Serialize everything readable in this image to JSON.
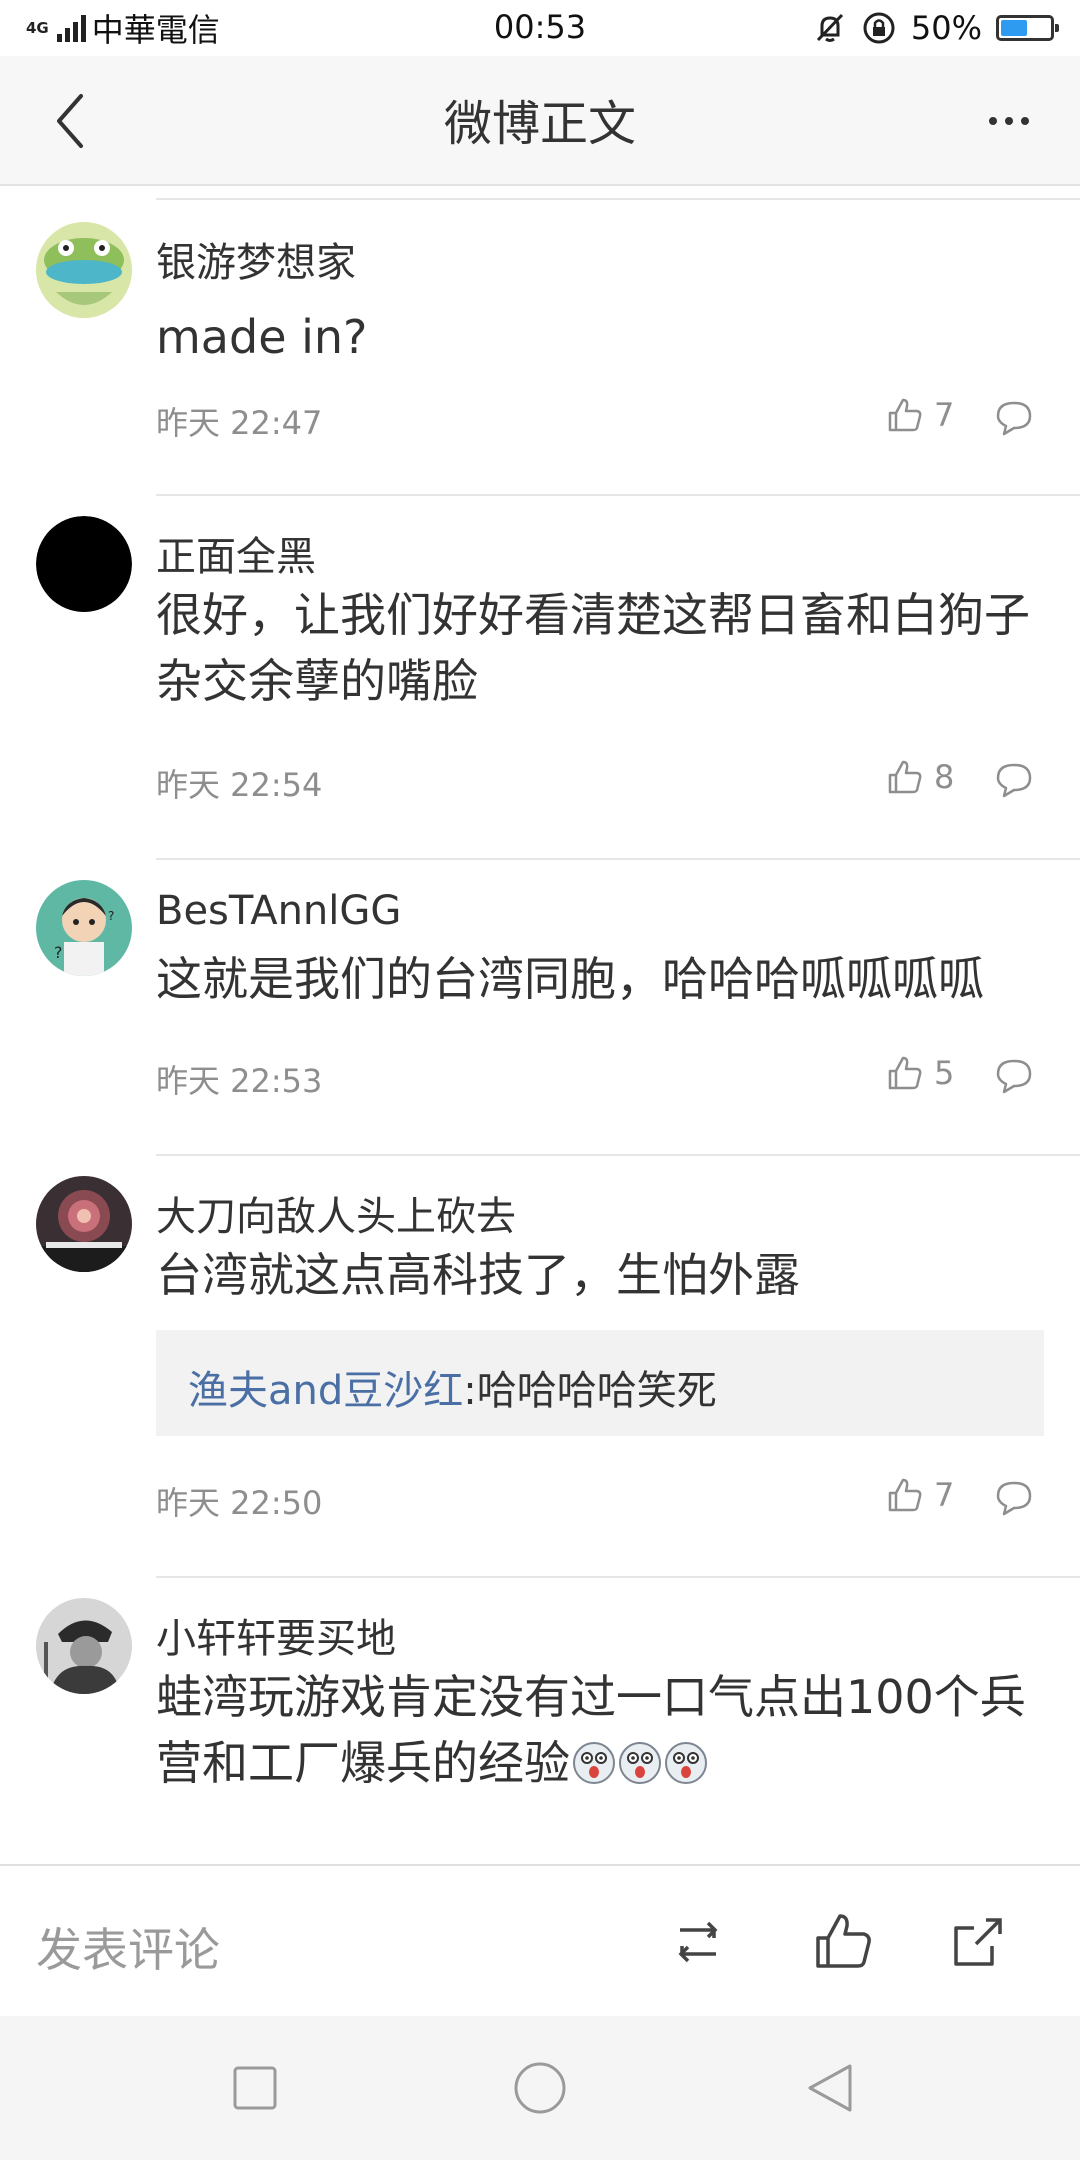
{
  "status_bar": {
    "network": "4G",
    "carrier": "中華電信",
    "time": "00:53",
    "battery": "50%",
    "battery_level": 0.5
  },
  "header": {
    "title": "微博正文",
    "back_icon": "chevron-left-icon",
    "more_icon": "more-dots-icon"
  },
  "comments": [
    {
      "username": "银游梦想家",
      "text": "made in?",
      "time": "昨天 22:47",
      "likes": "7"
    },
    {
      "username": "正面全黑",
      "text": "很好，让我们好好看清楚这帮日畜和白狗子杂交余孽的嘴脸",
      "time": "昨天 22:54",
      "likes": "8"
    },
    {
      "username": "BesTAnnlGG",
      "text": "这就是我们的台湾同胞，哈哈哈呱呱呱呱",
      "time": "昨天 22:53",
      "likes": "5"
    },
    {
      "username": "大刀向敌人头上砍去",
      "text": "台湾就这点高科技了，生怕外露",
      "time": "昨天 22:50",
      "likes": "7",
      "reply": {
        "user": "渔夫and豆沙红",
        "text": ":哈哈哈哈笑死"
      }
    },
    {
      "username": "小轩轩要买地",
      "text": "蛙湾玩游戏肯定没有过一口气点出100个兵营和工厂爆兵的经验",
      "time": "",
      "likes": ""
    }
  ],
  "bottom_bar": {
    "placeholder": "发表评论",
    "icons": [
      "repost-icon",
      "like-icon",
      "share-icon"
    ]
  },
  "nav_bar": {
    "icons": [
      "recents-square-icon",
      "home-circle-icon",
      "back-triangle-icon"
    ]
  },
  "colors": {
    "link": "#4a6fa5",
    "secondary_text": "#8e8e8e",
    "battery": "#2e9bf0",
    "header_bg": "#f7f7f7"
  }
}
